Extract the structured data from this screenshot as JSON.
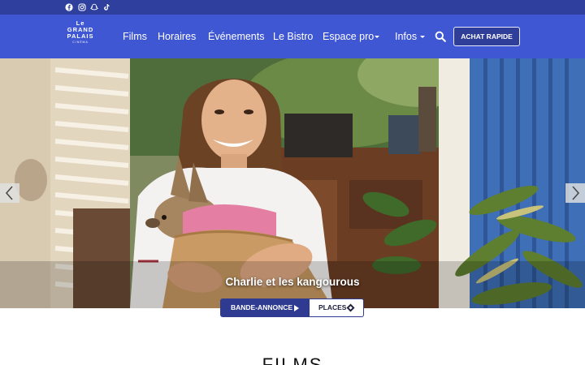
{
  "topbar": {
    "color": "#2e3f9e",
    "social_icons": [
      "facebook-icon",
      "instagram-icon",
      "snapchat-icon",
      "tiktok-icon"
    ]
  },
  "header": {
    "color": "#3f57d3",
    "logo": {
      "line1": "Le",
      "line2": "GRAND",
      "line3": "PALAIS",
      "line4": "CINÉMA"
    },
    "nav": {
      "films": "Films",
      "horaires": "Horaires",
      "evenements": "Événements",
      "bistro": "Le Bistro",
      "espace_pro": "Espace pro",
      "infos": "Infos"
    },
    "search_icon": "search-icon",
    "quick_buy": "ACHAT RAPIDE"
  },
  "hero": {
    "title": "Charlie et les kangourous",
    "trailer_label": "BANDE-ANNONCE",
    "places_label": "PLACES",
    "prev_icon": "chevron-left-icon",
    "next_icon": "chevron-right-icon"
  },
  "main": {
    "section_title": "FILMS"
  },
  "colors": {
    "accent": "#2e3b91",
    "nav_bg": "#3f57d3",
    "topbar_bg": "#2e3f9e"
  }
}
